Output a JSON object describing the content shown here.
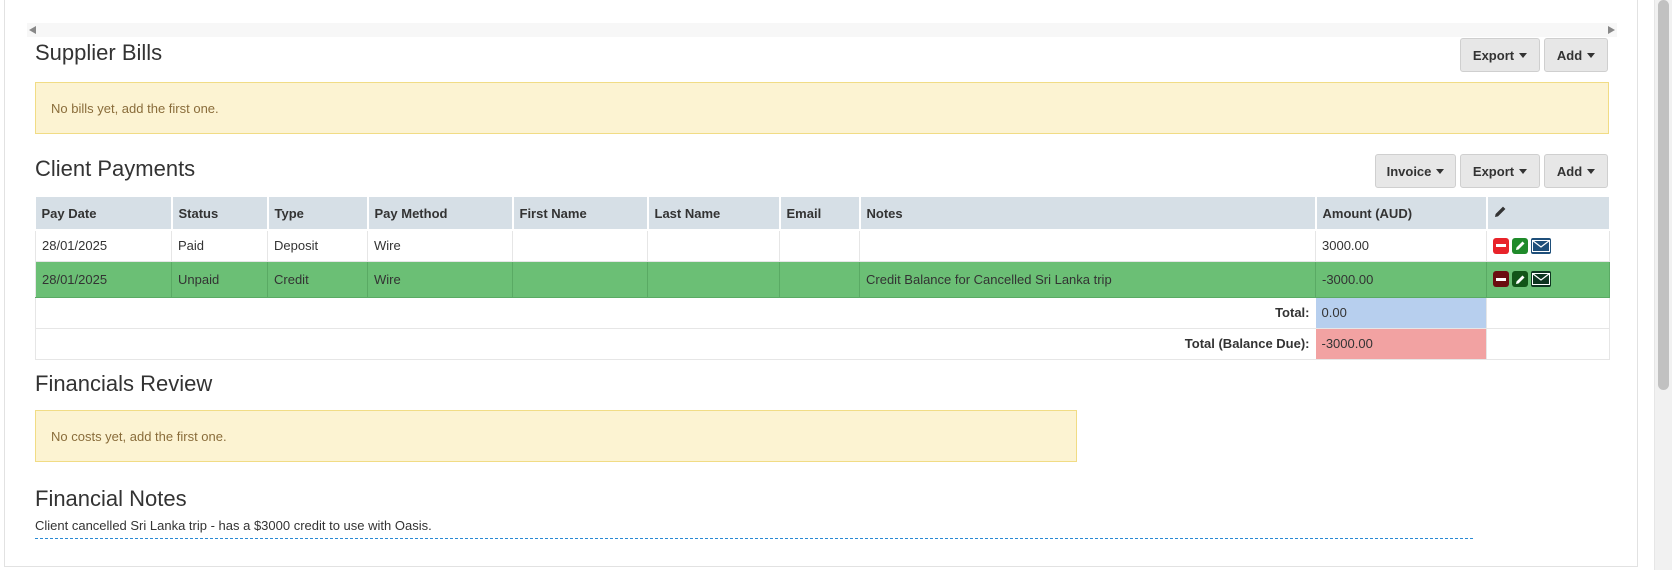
{
  "supplier_bills": {
    "title": "Supplier Bills",
    "export_label": "Export",
    "add_label": "Add",
    "empty_message": "No bills yet, add the first one."
  },
  "client_payments": {
    "title": "Client Payments",
    "invoice_label": "Invoice",
    "export_label": "Export",
    "add_label": "Add",
    "columns": [
      "Pay Date",
      "Status",
      "Type",
      "Pay Method",
      "First Name",
      "Last Name",
      "Email",
      "Notes",
      "Amount (AUD)"
    ],
    "rows": [
      {
        "pay_date": "28/01/2025",
        "status": "Paid",
        "type": "Deposit",
        "pay_method": "Wire",
        "first_name": "",
        "last_name": "",
        "email": "",
        "notes": "",
        "amount": "3000.00"
      },
      {
        "pay_date": "28/01/2025",
        "status": "Unpaid",
        "type": "Credit",
        "pay_method": "Wire",
        "first_name": "",
        "last_name": "",
        "email": "",
        "notes": "Credit Balance for Cancelled Sri Lanka trip",
        "amount": "-3000.00"
      }
    ],
    "total_label": "Total:",
    "total_value": "0.00",
    "balance_label": "Total (Balance Due):",
    "balance_value": "-3000.00",
    "colors": {
      "unpaid_row": "#6bbf75",
      "total_cell": "#b7cfee",
      "balance_cell": "#f2a2a2"
    },
    "icons": [
      "remove-icon",
      "edit-icon",
      "mail-icon",
      "pencil-icon"
    ]
  },
  "financials_review": {
    "title": "Financials Review",
    "empty_message": "No costs yet, add the first one."
  },
  "financial_notes": {
    "title": "Financial Notes",
    "text": "Client cancelled Sri Lanka trip - has a $3000 credit to use with Oasis."
  }
}
